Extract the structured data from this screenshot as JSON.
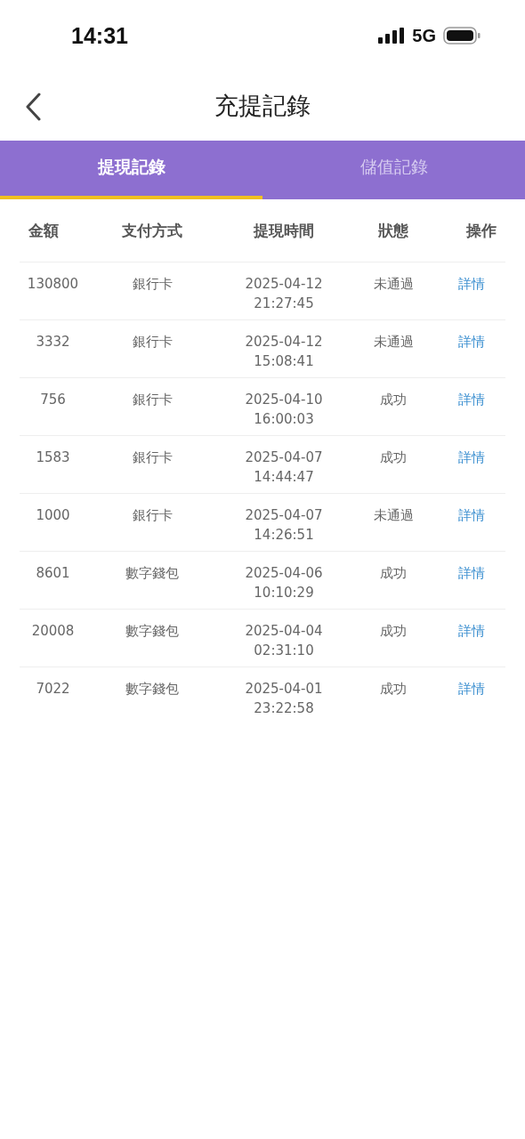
{
  "status_bar": {
    "time": "14:31",
    "network": "5G"
  },
  "header": {
    "title": "充提記錄"
  },
  "tabs": [
    {
      "label": "提現記錄",
      "selected": true
    },
    {
      "label": "儲值記錄",
      "selected": false
    }
  ],
  "table": {
    "columns": [
      "金額",
      "支付方式",
      "提現時間",
      "狀態",
      "操作"
    ],
    "rows": [
      {
        "amount": "130800",
        "method": "銀行卡",
        "date": "2025-04-12",
        "time": "21:27:45",
        "status": "未通過",
        "action": "詳情"
      },
      {
        "amount": "3332",
        "method": "銀行卡",
        "date": "2025-04-12",
        "time": "15:08:41",
        "status": "未通過",
        "action": "詳情"
      },
      {
        "amount": "756",
        "method": "銀行卡",
        "date": "2025-04-10",
        "time": "16:00:03",
        "status": "成功",
        "action": "詳情"
      },
      {
        "amount": "1583",
        "method": "銀行卡",
        "date": "2025-04-07",
        "time": "14:44:47",
        "status": "成功",
        "action": "詳情"
      },
      {
        "amount": "1000",
        "method": "銀行卡",
        "date": "2025-04-07",
        "time": "14:26:51",
        "status": "未通過",
        "action": "詳情"
      },
      {
        "amount": "8601",
        "method": "數字錢包",
        "date": "2025-04-06",
        "time": "10:10:29",
        "status": "成功",
        "action": "詳情"
      },
      {
        "amount": "20008",
        "method": "數字錢包",
        "date": "2025-04-04",
        "time": "02:31:10",
        "status": "成功",
        "action": "詳情"
      },
      {
        "amount": "7022",
        "method": "數字錢包",
        "date": "2025-04-01",
        "time": "23:22:58",
        "status": "成功",
        "action": "詳情"
      }
    ]
  }
}
